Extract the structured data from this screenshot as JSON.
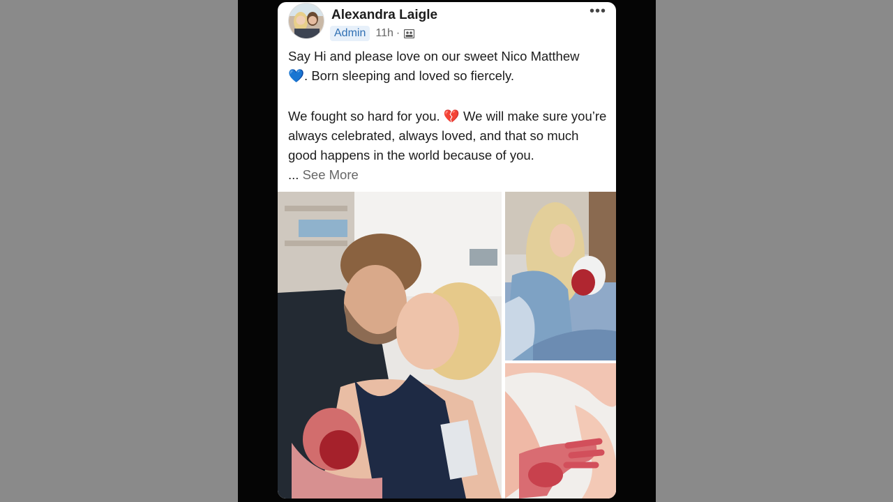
{
  "post": {
    "author": "Alexandra Laigle",
    "role_badge": "Admin",
    "time": "11h",
    "separator": "·",
    "more_icon": "more-horizontal-icon",
    "audience_icon": "group-members-icon",
    "line1": "Say Hi and please love on our sweet Nico Matthew",
    "heart": "💙",
    "line2": ". Born sleeping and loved so fiercely.",
    "para2_a": "We fought so hard for you.",
    "broken_heart": "💔",
    "para2_b": "We will make sure you’re always celebrated, always loved, and that so much good happens in the world because of you.",
    "see_more_prefix": "...",
    "see_more": "See More"
  },
  "colors": {
    "badge_bg": "#e7f0fa",
    "badge_text": "#2f6fb3",
    "card_bg": "#ffffff"
  }
}
